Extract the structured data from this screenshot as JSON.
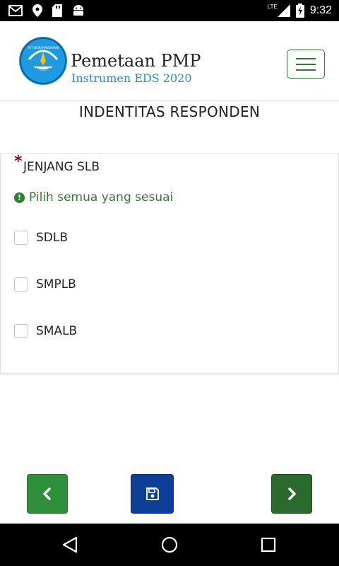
{
  "status_bar": {
    "time": "9:32",
    "network": "LTE",
    "icons": [
      "gmail-icon",
      "location-pin-icon",
      "sd-card-icon",
      "android-icon",
      "signal-icon",
      "battery-charging-icon"
    ]
  },
  "header": {
    "logo_text": "TUT WURI HANDAYANI",
    "title": "Pemetaan PMP",
    "subtitle": "Instrumen EDS 2020",
    "menu_icon": "hamburger-icon"
  },
  "page": {
    "title": "INDENTITAS RESPONDEN"
  },
  "question": {
    "required_mark": "*",
    "label": "JENJANG SLB",
    "hint_icon": "!",
    "hint": "Pilih semua yang sesuai",
    "options": [
      {
        "label": "SDLB",
        "checked": false
      },
      {
        "label": "SMPLB",
        "checked": false
      },
      {
        "label": "SMALB",
        "checked": false
      }
    ]
  },
  "actions": {
    "prev_icon": "chevron-left-icon",
    "save_icon": "save-icon",
    "next_icon": "chevron-right-icon"
  },
  "colors": {
    "primary_green": "#2e7d32",
    "save_blue": "#0d3f99",
    "logo_blue": "#1e9be0",
    "required_red": "#8b1a1a"
  }
}
